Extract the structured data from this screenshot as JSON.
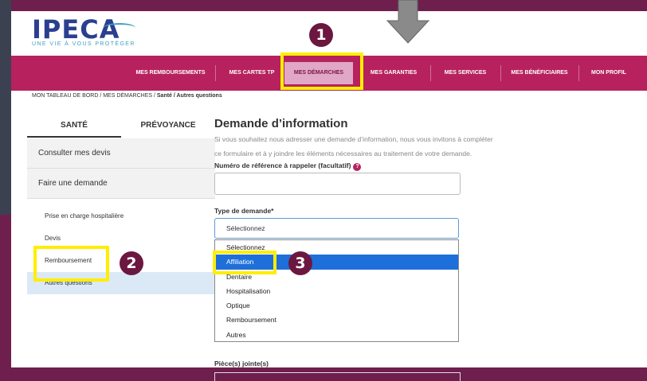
{
  "logo": {
    "name": "IPECA",
    "tagline": "UNE VIE À VOUS PROTÉGER"
  },
  "nav": {
    "items": [
      "MES REMBOURSEMENTS",
      "MES CARTES TP",
      "MES DÉMARCHES",
      "MES GARANTIES",
      "MES SERVICES",
      "MES BÉNÉFICIAIRES",
      "MON PROFIL"
    ],
    "active": "MES DÉMARCHES"
  },
  "breadcrumb": {
    "path": "MON TABLEAU DE BORD / MES DÉMARCHES / ",
    "santé": "Santé",
    "sep": " / ",
    "current": "Autres questions"
  },
  "tabs": [
    "SANTÉ",
    "PRÉVOYANCE"
  ],
  "sidebar": {
    "items": [
      "Consulter mes devis",
      "Faire une demande"
    ],
    "subitems": [
      "Prise en charge hospitalière",
      "Devis",
      "Remboursement",
      "Autres questions"
    ],
    "selected": "Autres questions"
  },
  "form": {
    "title": "Demande d’information",
    "intro_line1": "Si vous souhaitez nous adresser une demande d’information, nous vous invitons à compléter",
    "intro_line2": "ce formulaire et à y joindre les éléments nécessaires au traitement de votre demande.",
    "ref_label": "Numéro de référence à rappeler (facultatif)",
    "ref_help": "?",
    "type_label": "Type de demande*",
    "type_value": "Sélectionnez",
    "options": [
      "Sélectionnez",
      "Affiliation",
      "Dentaire",
      "Hospitalisation",
      "Optique",
      "Remboursement",
      "Autres"
    ],
    "highlighted_option": "Affiliation",
    "attach_label": "Pièce(s) jointe(s)"
  },
  "annotations": {
    "step1": "1",
    "step2": "2",
    "step3": "3",
    "highlight_color": "#ffee00",
    "badge_color": "#6b1740"
  },
  "colors": {
    "brand": "#b7225e",
    "accent": "#2a3f8f"
  }
}
